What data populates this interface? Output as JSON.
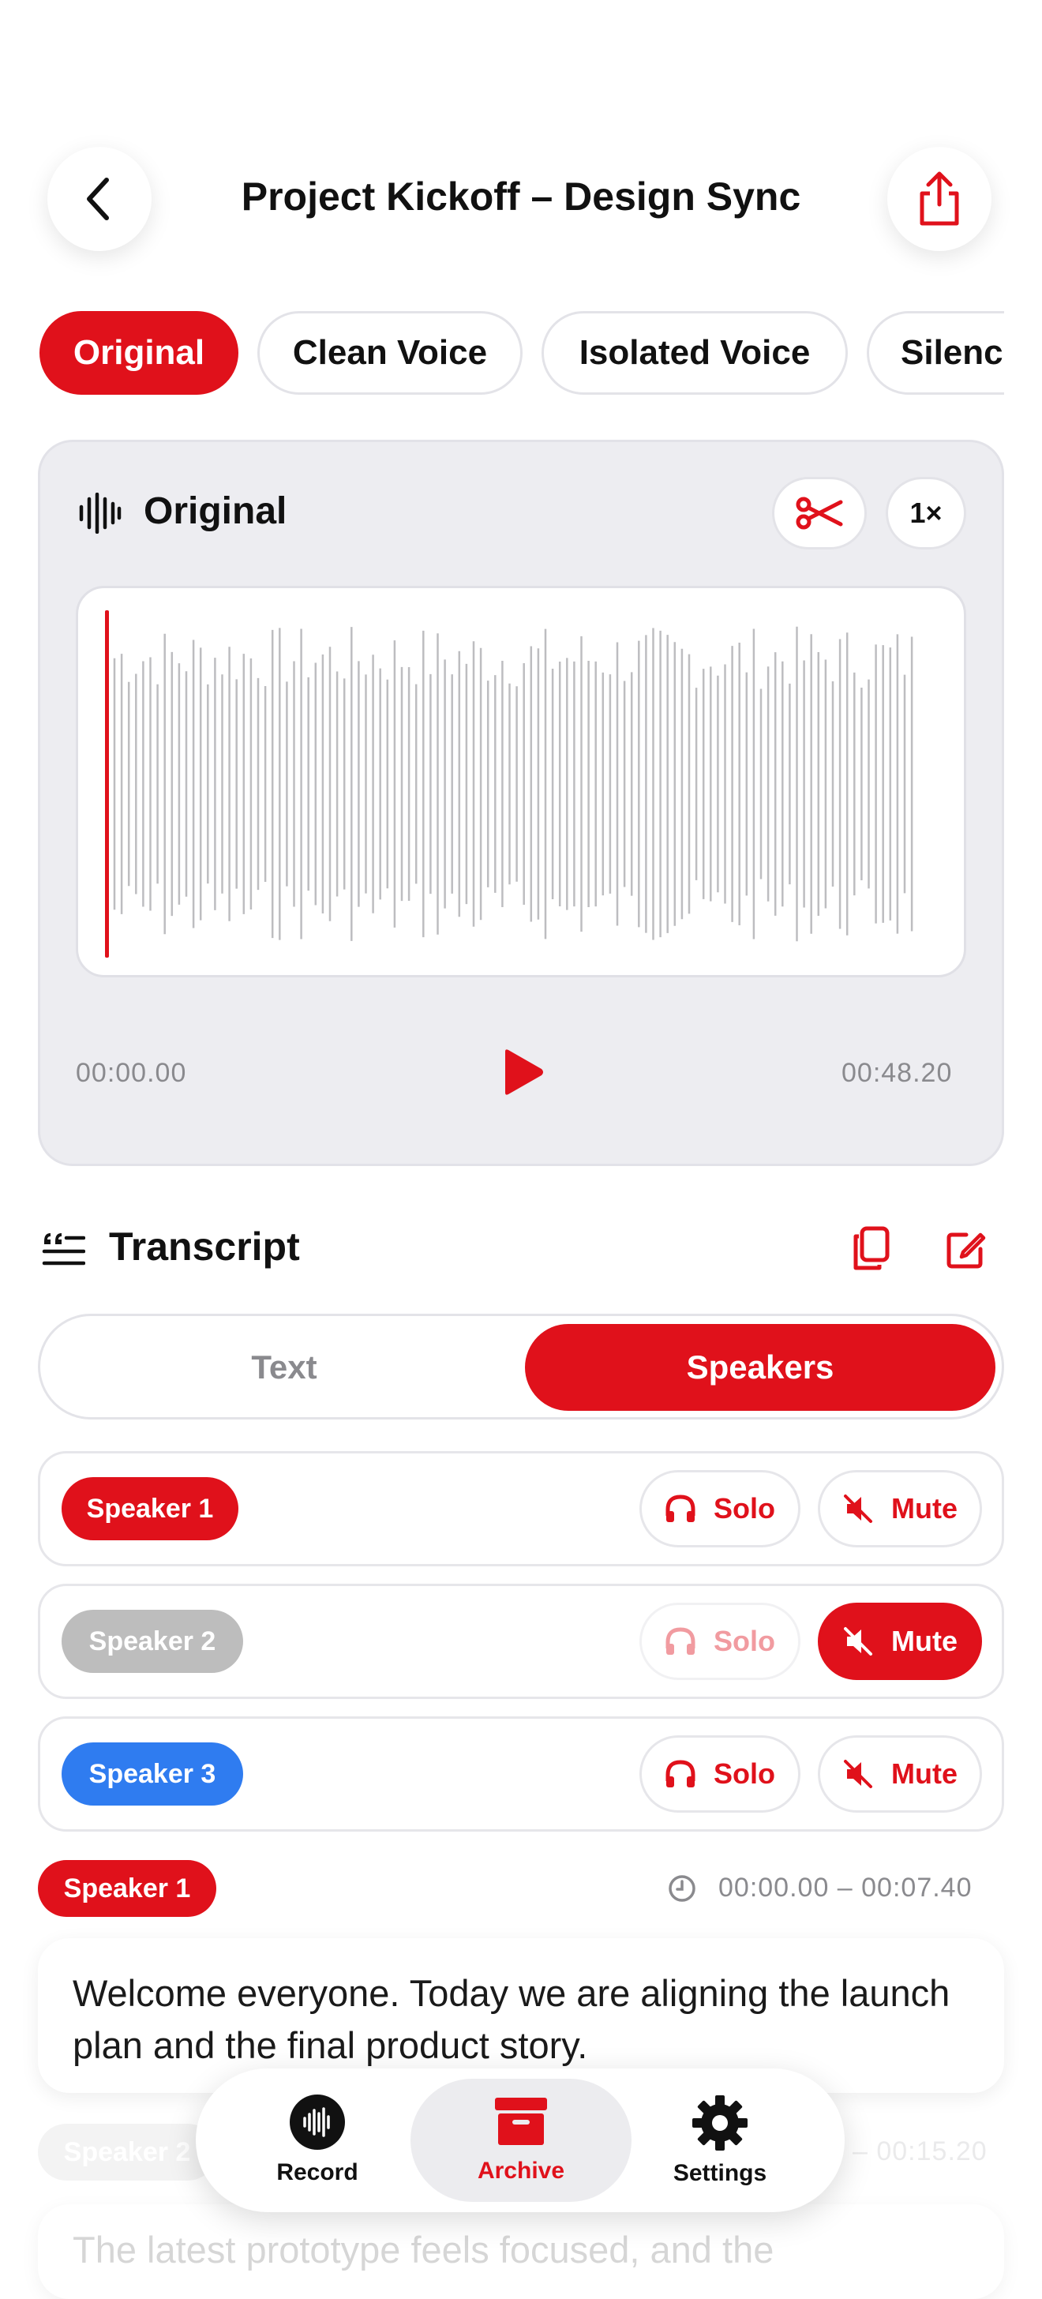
{
  "header": {
    "title": "Project Kickoff – Design Sync",
    "back_icon": "chevron-left-icon",
    "share_icon": "share-icon"
  },
  "filters": [
    {
      "label": "Original",
      "active": true
    },
    {
      "label": "Clean Voice",
      "active": false
    },
    {
      "label": "Isolated Voice",
      "active": false
    },
    {
      "label": "Silence",
      "active": false
    }
  ],
  "player": {
    "title": "Original",
    "speed": "1×",
    "current_time": "00:00.00",
    "duration": "00:48.20",
    "playback_progress": 0.0
  },
  "transcript": {
    "title": "Transcript",
    "tabs": {
      "text": "Text",
      "speakers": "Speakers",
      "active": "speakers"
    }
  },
  "speakers": [
    {
      "label": "Speaker 1",
      "color": "#e0111b",
      "solo": "Solo",
      "mute": "Mute",
      "muted": false
    },
    {
      "label": "Speaker 2",
      "color": "#bdbdbd",
      "solo": "Solo",
      "mute": "Mute",
      "muted": true
    },
    {
      "label": "Speaker 3",
      "color": "#2f7cf0",
      "solo": "Solo",
      "mute": "Mute",
      "muted": false
    }
  ],
  "segments": [
    {
      "speaker": "Speaker 1",
      "time": "00:00.00 – 00:07.40",
      "text": "Welcome everyone. Today we are aligning the launch plan and the final product story."
    },
    {
      "speaker": "Speaker 2",
      "time": "– 00:15.20",
      "text": "The latest prototype feels focused, and the"
    }
  ],
  "tabbar": {
    "record": "Record",
    "archive": "Archive",
    "settings": "Settings",
    "active": "archive"
  },
  "colors": {
    "accent": "#e0111b",
    "muted_grey": "#8a8a8e"
  }
}
